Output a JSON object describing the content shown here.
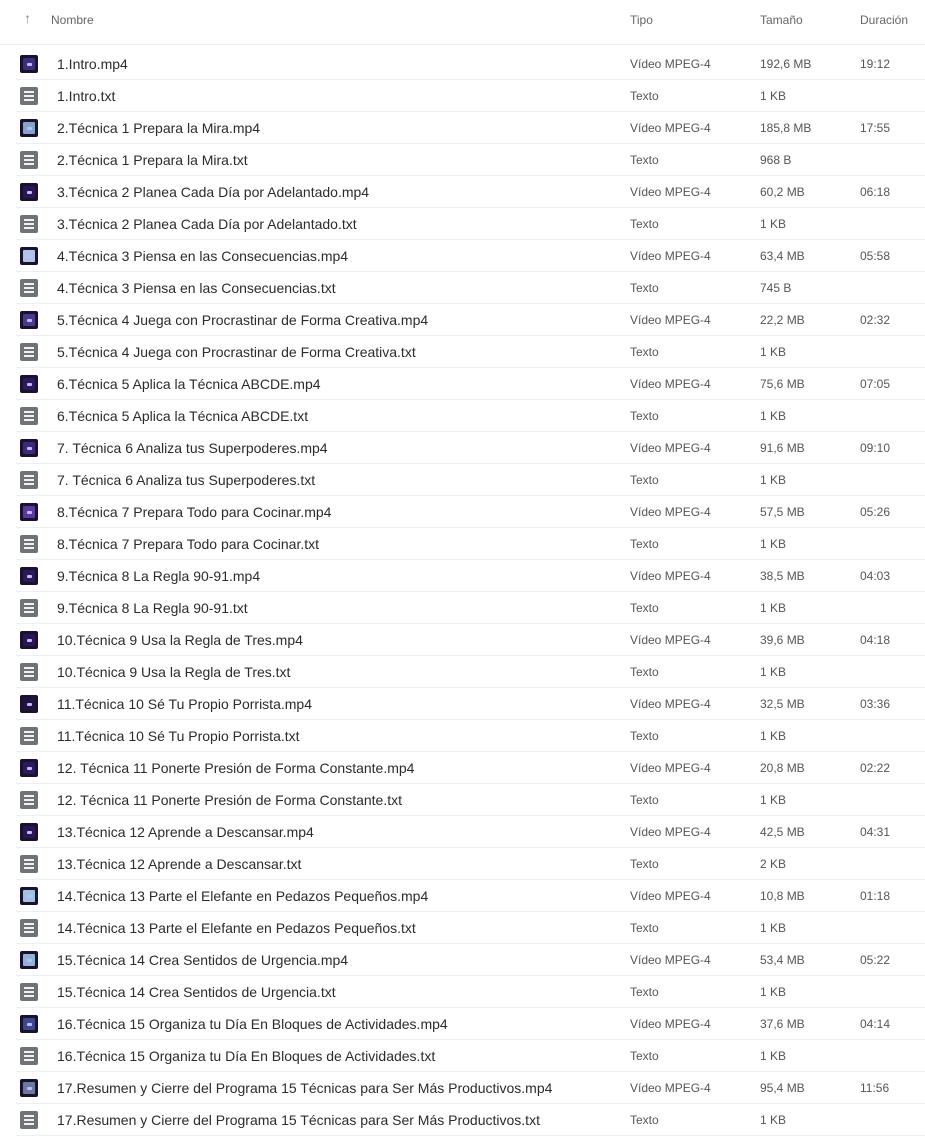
{
  "header": {
    "name_label": "Nombre",
    "type_label": "Tipo",
    "size_label": "Tamaño",
    "duration_label": "Duración",
    "sort_icon": "arrow-up-icon"
  },
  "files": [
    {
      "name": "1.Intro.mp4",
      "type": "Vídeo MPEG-4",
      "size": "192,6 MB",
      "duration": "19:12",
      "kind": "video",
      "thumb_color": "#3a2f7a"
    },
    {
      "name": "1.Intro.txt",
      "type": "Texto",
      "size": "1 KB",
      "duration": "",
      "kind": "text"
    },
    {
      "name": "2.Técnica 1 Prepara la Mira.mp4",
      "type": "Vídeo MPEG-4",
      "size": "185,8 MB",
      "duration": "17:55",
      "kind": "video",
      "thumb_color": "#7fa7c9"
    },
    {
      "name": "2.Técnica 1 Prepara la Mira.txt",
      "type": "Texto",
      "size": "968 B",
      "duration": "",
      "kind": "text"
    },
    {
      "name": "3.Técnica 2 Planea Cada Día por Adelantado.mp4",
      "type": "Vídeo MPEG-4",
      "size": "60,2 MB",
      "duration": "06:18",
      "kind": "video",
      "thumb_color": "#2a1650"
    },
    {
      "name": "3.Técnica 2 Planea Cada Día por Adelantado.txt",
      "type": "Texto",
      "size": "1 KB",
      "duration": "",
      "kind": "text"
    },
    {
      "name": "4.Técnica 3 Piensa en las Consecuencias.mp4",
      "type": "Vídeo MPEG-4",
      "size": "63,4 MB",
      "duration": "05:58",
      "kind": "video",
      "thumb_color": "#a9c6e6"
    },
    {
      "name": "4.Técnica 3 Piensa en las Consecuencias.txt",
      "type": "Texto",
      "size": "745 B",
      "duration": "",
      "kind": "text"
    },
    {
      "name": "5.Técnica 4 Juega con Procrastinar de Forma Creativa.mp4",
      "type": "Vídeo MPEG-4",
      "size": "22,2 MB",
      "duration": "02:32",
      "kind": "video",
      "thumb_color": "#4a3a8a"
    },
    {
      "name": "5.Técnica 4 Juega con Procrastinar de Forma Creativa.txt",
      "type": "Texto",
      "size": "1 KB",
      "duration": "",
      "kind": "text"
    },
    {
      "name": "6.Técnica 5 Aplica la Técnica ABCDE.mp4",
      "type": "Vídeo MPEG-4",
      "size": "75,6 MB",
      "duration": "07:05",
      "kind": "video",
      "thumb_color": "#2b1a5e"
    },
    {
      "name": "6.Técnica 5 Aplica la Técnica ABCDE.txt",
      "type": "Texto",
      "size": "1 KB",
      "duration": "",
      "kind": "text"
    },
    {
      "name": "7. Técnica 6 Analiza tus Superpoderes.mp4",
      "type": "Vídeo MPEG-4",
      "size": "91,6 MB",
      "duration": "09:10",
      "kind": "video",
      "thumb_color": "#3b2a7a"
    },
    {
      "name": "7. Técnica 6 Analiza tus Superpoderes.txt",
      "type": "Texto",
      "size": "1 KB",
      "duration": "",
      "kind": "text"
    },
    {
      "name": "8.Técnica 7 Prepara Todo para Cocinar.mp4",
      "type": "Vídeo MPEG-4",
      "size": "57,5 MB",
      "duration": "05:26",
      "kind": "video",
      "thumb_color": "#5a3aa0"
    },
    {
      "name": "8.Técnica 7 Prepara Todo para Cocinar.txt",
      "type": "Texto",
      "size": "1 KB",
      "duration": "",
      "kind": "text"
    },
    {
      "name": "9.Técnica 8 La Regla 90-91.mp4",
      "type": "Vídeo MPEG-4",
      "size": "38,5 MB",
      "duration": "04:03",
      "kind": "video",
      "thumb_color": "#2a1a55"
    },
    {
      "name": "9.Técnica 8 La Regla 90-91.txt",
      "type": "Texto",
      "size": "1 KB",
      "duration": "",
      "kind": "text"
    },
    {
      "name": "10.Técnica 9 Usa la Regla de Tres.mp4",
      "type": "Vídeo MPEG-4",
      "size": "39,6 MB",
      "duration": "04:18",
      "kind": "video",
      "thumb_color": "#2a1650"
    },
    {
      "name": "10.Técnica 9 Usa la Regla de Tres.txt",
      "type": "Texto",
      "size": "1 KB",
      "duration": "",
      "kind": "text"
    },
    {
      "name": "11.Técnica 10 Sé Tu Propio Porrista.mp4",
      "type": "Vídeo MPEG-4",
      "size": "32,5 MB",
      "duration": "03:36",
      "kind": "video",
      "thumb_color": "#1f1440"
    },
    {
      "name": "11.Técnica 10 Sé Tu Propio Porrista.txt",
      "type": "Texto",
      "size": "1 KB",
      "duration": "",
      "kind": "text"
    },
    {
      "name": "12. Técnica 11 Ponerte Presión de Forma Constante.mp4",
      "type": "Vídeo MPEG-4",
      "size": "20,8 MB",
      "duration": "02:22",
      "kind": "video",
      "thumb_color": "#2a1a60"
    },
    {
      "name": "12. Técnica 11 Ponerte Presión de Forma Constante.txt",
      "type": "Texto",
      "size": "1 KB",
      "duration": "",
      "kind": "text"
    },
    {
      "name": "13.Técnica 12 Aprende a Descansar.mp4",
      "type": "Vídeo MPEG-4",
      "size": "42,5 MB",
      "duration": "04:31",
      "kind": "video",
      "thumb_color": "#2a1650"
    },
    {
      "name": "13.Técnica 12 Aprende a Descansar.txt",
      "type": "Texto",
      "size": "2 KB",
      "duration": "",
      "kind": "text"
    },
    {
      "name": "14.Técnica 13 Parte el Elefante en Pedazos Pequeños.mp4",
      "type": "Vídeo MPEG-4",
      "size": "10,8 MB",
      "duration": "01:18",
      "kind": "video",
      "thumb_color": "#9cc3e0"
    },
    {
      "name": "14.Técnica 13 Parte el Elefante en Pedazos Pequeños.txt",
      "type": "Texto",
      "size": "1 KB",
      "duration": "",
      "kind": "text"
    },
    {
      "name": "15.Técnica 14 Crea Sentidos de Urgencia.mp4",
      "type": "Vídeo MPEG-4",
      "size": "53,4 MB",
      "duration": "05:22",
      "kind": "video",
      "thumb_color": "#8fb5d5"
    },
    {
      "name": "15.Técnica 14 Crea Sentidos de Urgencia.txt",
      "type": "Texto",
      "size": "1 KB",
      "duration": "",
      "kind": "text"
    },
    {
      "name": "16.Técnica 15 Organiza tu Día En Bloques de Actividades.mp4",
      "type": "Vídeo MPEG-4",
      "size": "37,6 MB",
      "duration": "04:14",
      "kind": "video",
      "thumb_color": "#3a4a8a"
    },
    {
      "name": "16.Técnica 15 Organiza tu Día En Bloques de Actividades.txt",
      "type": "Texto",
      "size": "1 KB",
      "duration": "",
      "kind": "text"
    },
    {
      "name": "17.Resumen y Cierre del Programa 15 Técnicas para Ser Más Productivos.mp4",
      "type": "Vídeo MPEG-4",
      "size": "95,4 MB",
      "duration": "11:56",
      "kind": "video",
      "thumb_color": "#6a7aa0"
    },
    {
      "name": "17.Resumen y Cierre del Programa 15 Técnicas para Ser Más Productivos.txt",
      "type": "Texto",
      "size": "1 KB",
      "duration": "",
      "kind": "text"
    }
  ]
}
